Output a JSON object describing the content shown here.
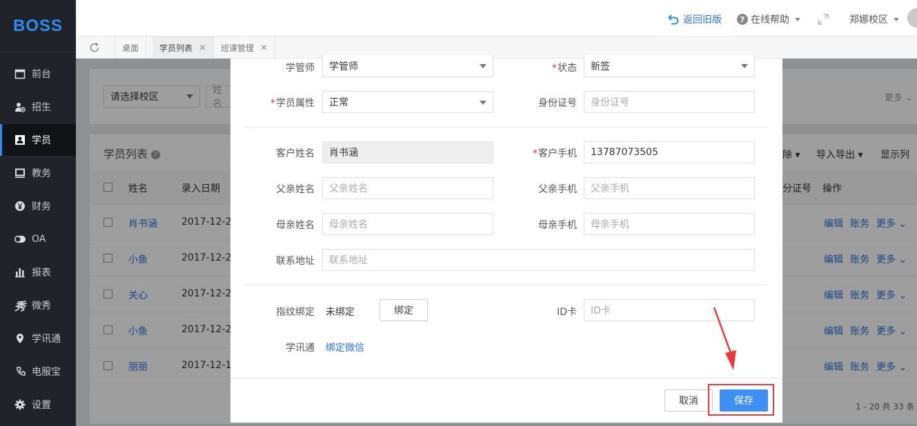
{
  "sidebar": {
    "logo": "BOSS",
    "items": [
      {
        "label": "前台",
        "icon": "calendar-icon"
      },
      {
        "label": "招生",
        "icon": "user-add-icon"
      },
      {
        "label": "学员",
        "icon": "user-card-icon"
      },
      {
        "label": "教务",
        "icon": "board-icon"
      },
      {
        "label": "财务",
        "icon": "yen-icon"
      },
      {
        "label": "OA",
        "icon": "toggle-icon"
      },
      {
        "label": "报表",
        "icon": "bar-chart-icon"
      },
      {
        "label": "微秀",
        "icon": "xiu-icon"
      },
      {
        "label": "学讯通",
        "icon": "location-icon"
      },
      {
        "label": "电服宝",
        "icon": "phone-icon"
      },
      {
        "label": "设置",
        "icon": "gear-icon"
      }
    ]
  },
  "topbar": {
    "back_old": "返回旧版",
    "help": "在线帮助",
    "campus": "郑娜校区"
  },
  "tabs": [
    {
      "label": "桌面"
    },
    {
      "label": "学员列表"
    },
    {
      "label": "班课管理"
    }
  ],
  "background": {
    "campus_select": "请选择校区",
    "name_filter": "姓名",
    "more": "更多",
    "list_title": "学员列表",
    "toolbar": [
      "除",
      "导入导出",
      "显示列"
    ],
    "columns": {
      "name": "姓名",
      "date": "录入日期",
      "id": "分证号",
      "ops": "操作"
    },
    "rows": [
      {
        "name": "肖书涵",
        "date": "2017-12-2"
      },
      {
        "name": "小鱼",
        "date": "2017-12-2"
      },
      {
        "name": "关心",
        "date": "2017-12-2"
      },
      {
        "name": "小鱼",
        "date": "2017-12-2"
      },
      {
        "name": "丽丽",
        "date": "2017-12-1"
      }
    ],
    "row_actions": {
      "edit": "编辑",
      "account": "账务",
      "more": "更多"
    },
    "pagination": "1 - 20  共 33 条"
  },
  "form": {
    "manager_label": "学管师",
    "manager_value": "学管师",
    "status_label": "状态",
    "status_value": "新签",
    "attr_label": "学员属性",
    "attr_value": "正常",
    "idcard_label": "身份证号",
    "idcard_placeholder": "身份证号",
    "customer_name_label": "客户姓名",
    "customer_name_value": "肖书涵",
    "customer_phone_label": "客户手机",
    "customer_phone_value": "13787073505",
    "father_name_label": "父亲姓名",
    "father_name_placeholder": "父亲姓名",
    "father_phone_label": "父亲手机",
    "father_phone_placeholder": "父亲手机",
    "mother_name_label": "母亲姓名",
    "mother_name_placeholder": "母亲姓名",
    "mother_phone_label": "母亲手机",
    "mother_phone_placeholder": "母亲手机",
    "address_label": "联系地址",
    "address_placeholder": "联系地址",
    "fingerprint_label": "指纹绑定",
    "fingerprint_status": "未绑定",
    "bind_button": "绑定",
    "idc_label": "ID卡",
    "idc_placeholder": "ID卡",
    "xuexuntong_label": "学讯通",
    "bind_wechat": "绑定微信"
  },
  "footer": {
    "cancel": "取消",
    "save": "保存"
  },
  "colors": {
    "primary": "#3d8ff5",
    "highlight": "#e4393c",
    "link": "#2d6fd6"
  }
}
